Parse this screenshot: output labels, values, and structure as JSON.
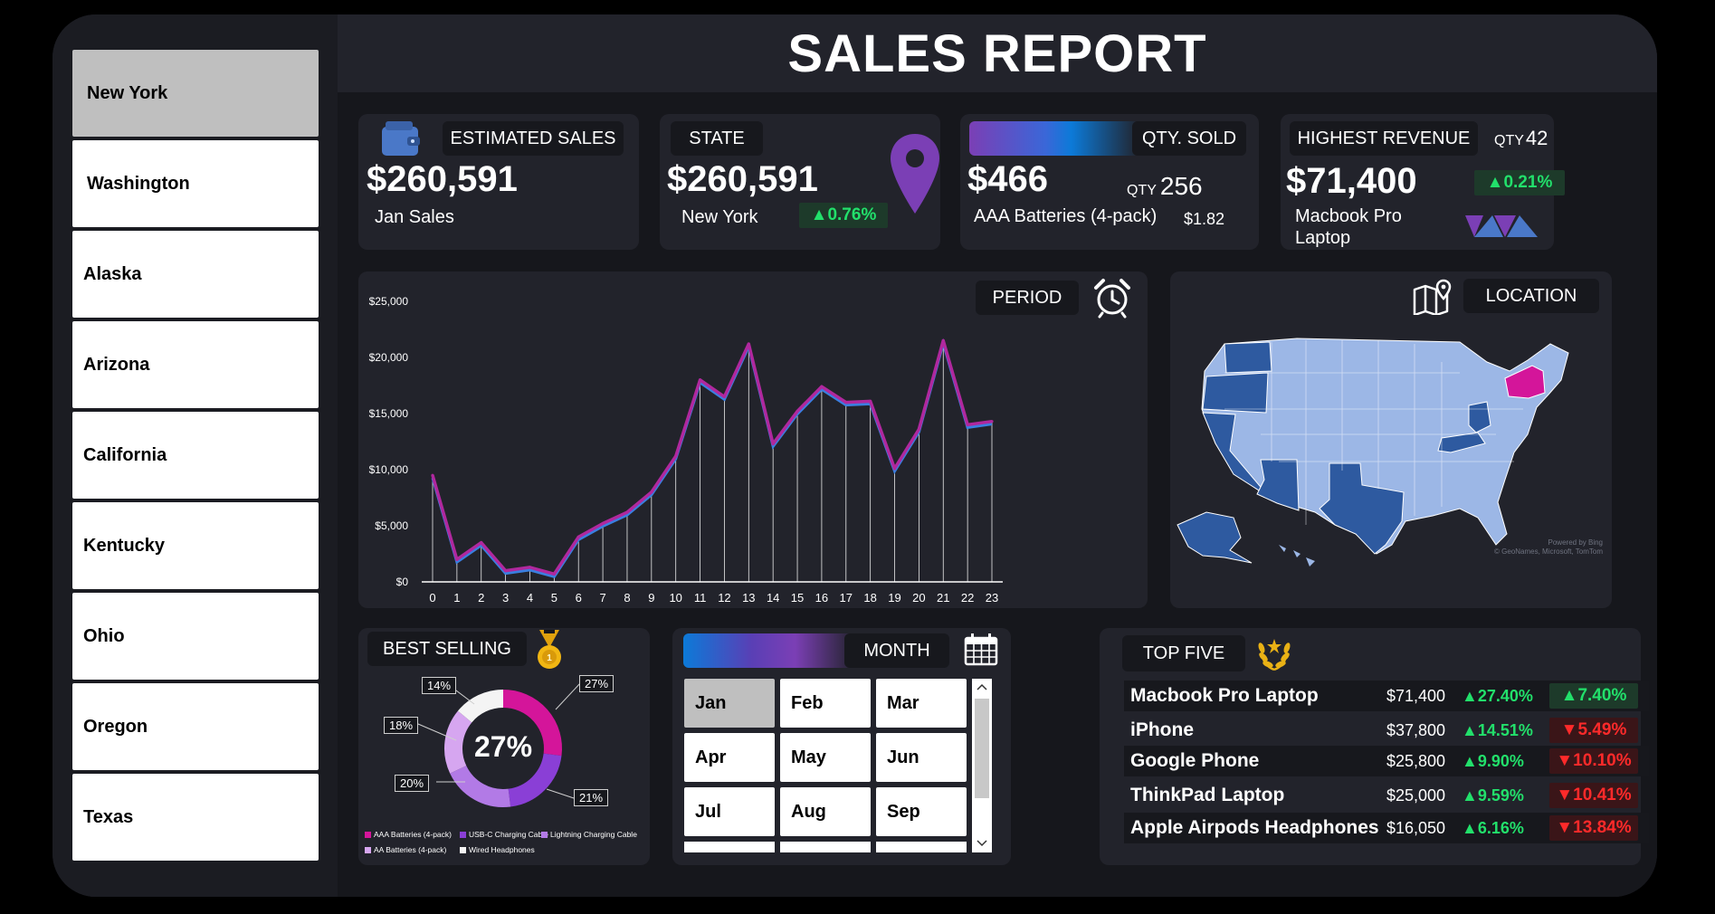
{
  "header": {
    "title": "SALES REPORT"
  },
  "sidebar": {
    "states": [
      "New York",
      "Washington",
      "Alaska",
      "Arizona",
      "California",
      "Kentucky",
      "Ohio",
      "Oregon",
      "Texas"
    ]
  },
  "kpi": {
    "estimated": {
      "label": "ESTIMATED SALES",
      "value": "$260,591",
      "sub": "Jan  Sales"
    },
    "state": {
      "label": "STATE",
      "value": "$260,591",
      "sub": "New York",
      "change": "▲0.76%"
    },
    "qty": {
      "label": "QTY. SOLD",
      "value": "$466",
      "qty_prefix": "QTY",
      "qty_value": "256",
      "product": "AAA Batteries (4-pack)",
      "price": "$1.82"
    },
    "highest": {
      "label": "HIGHEST REVENUE",
      "qty_prefix": "QTY",
      "qty_value": "42",
      "value": "$71,400",
      "change": "▲0.21%",
      "product_line1": "Macbook Pro",
      "product_line2": "Laptop"
    }
  },
  "period": {
    "label": "PERIOD"
  },
  "location": {
    "label": "LOCATION",
    "credit1": "Powered by Bing",
    "credit2": "© GeoNames, Microsoft, TomTom"
  },
  "best_selling": {
    "label": "BEST SELLING",
    "center": "27%",
    "labels": [
      "27%",
      "21%",
      "20%",
      "18%",
      "14%"
    ],
    "legend": [
      "AAA Batteries (4-pack)",
      "USB-C Charging Cable",
      "Lightning Charging Cable",
      "AA Batteries (4-pack)",
      "Wired Headphones"
    ]
  },
  "month": {
    "label": "MONTH",
    "months": [
      "Jan",
      "Feb",
      "Mar",
      "Apr",
      "May",
      "Jun",
      "Jul",
      "Aug",
      "Sep"
    ]
  },
  "top_five": {
    "label": "TOP FIVE",
    "rows": [
      {
        "name": "Macbook Pro Laptop",
        "revenue": "$71,400",
        "growth": "▲27.40%",
        "change": "▲7.40%",
        "positive": true
      },
      {
        "name": "iPhone",
        "revenue": "$37,800",
        "growth": "▲14.51%",
        "change": "▼5.49%",
        "positive": false
      },
      {
        "name": "Google Phone",
        "revenue": "$25,800",
        "growth": "▲9.90%",
        "change": "▼10.10%",
        "positive": false
      },
      {
        "name": "ThinkPad Laptop",
        "revenue": "$25,000",
        "growth": "▲9.59%",
        "change": "▼10.41%",
        "positive": false
      },
      {
        "name": "Apple Airpods Headphones",
        "revenue": "$16,050",
        "growth": "▲6.16%",
        "change": "▼13.84%",
        "positive": false
      }
    ]
  },
  "colors": {
    "accent_purple": "#7b3fb5",
    "accent_magenta": "#d4159a",
    "accent_blue": "#2f7fd8",
    "positive": "#22e06b",
    "negative": "#ff2a2a"
  },
  "chart_data": [
    {
      "type": "line",
      "x": [
        0,
        1,
        2,
        3,
        4,
        5,
        6,
        7,
        8,
        9,
        10,
        11,
        12,
        13,
        14,
        15,
        16,
        17,
        18,
        19,
        20,
        21,
        22,
        23
      ],
      "series": [
        {
          "values": [
            9500,
            2000,
            3500,
            1000,
            1300,
            700,
            4000,
            5200,
            6200,
            8000,
            11200,
            18000,
            16500,
            21200,
            12300,
            15200,
            17400,
            16000,
            16100,
            10100,
            13600,
            21500,
            14000,
            14300
          ]
        }
      ],
      "x_tick_labels": [
        "0",
        "1",
        "2",
        "3",
        "4",
        "5",
        "6",
        "7",
        "8",
        "9",
        "10",
        "11",
        "12",
        "13",
        "14",
        "15",
        "16",
        "17",
        "18",
        "19",
        "20",
        "21",
        "22",
        "23"
      ],
      "y_tick_labels": [
        "$0",
        "$5,000",
        "$10,000",
        "$15,000",
        "$20,000",
        "$25,000"
      ],
      "ylim": [
        0,
        25000
      ],
      "grid": false
    },
    {
      "type": "pie",
      "categories": [
        "AAA Batteries (4-pack)",
        "USB-C Charging Cable",
        "Lightning Charging Cable",
        "AA Batteries (4-pack)",
        "Wired Headphones"
      ],
      "values": [
        27,
        21,
        20,
        18,
        14
      ],
      "colors": [
        "#d4159a",
        "#8a3fd6",
        "#b27ae6",
        "#d6a6f0",
        "#f4f4f4"
      ],
      "donut": true,
      "legend": "bottom"
    }
  ]
}
